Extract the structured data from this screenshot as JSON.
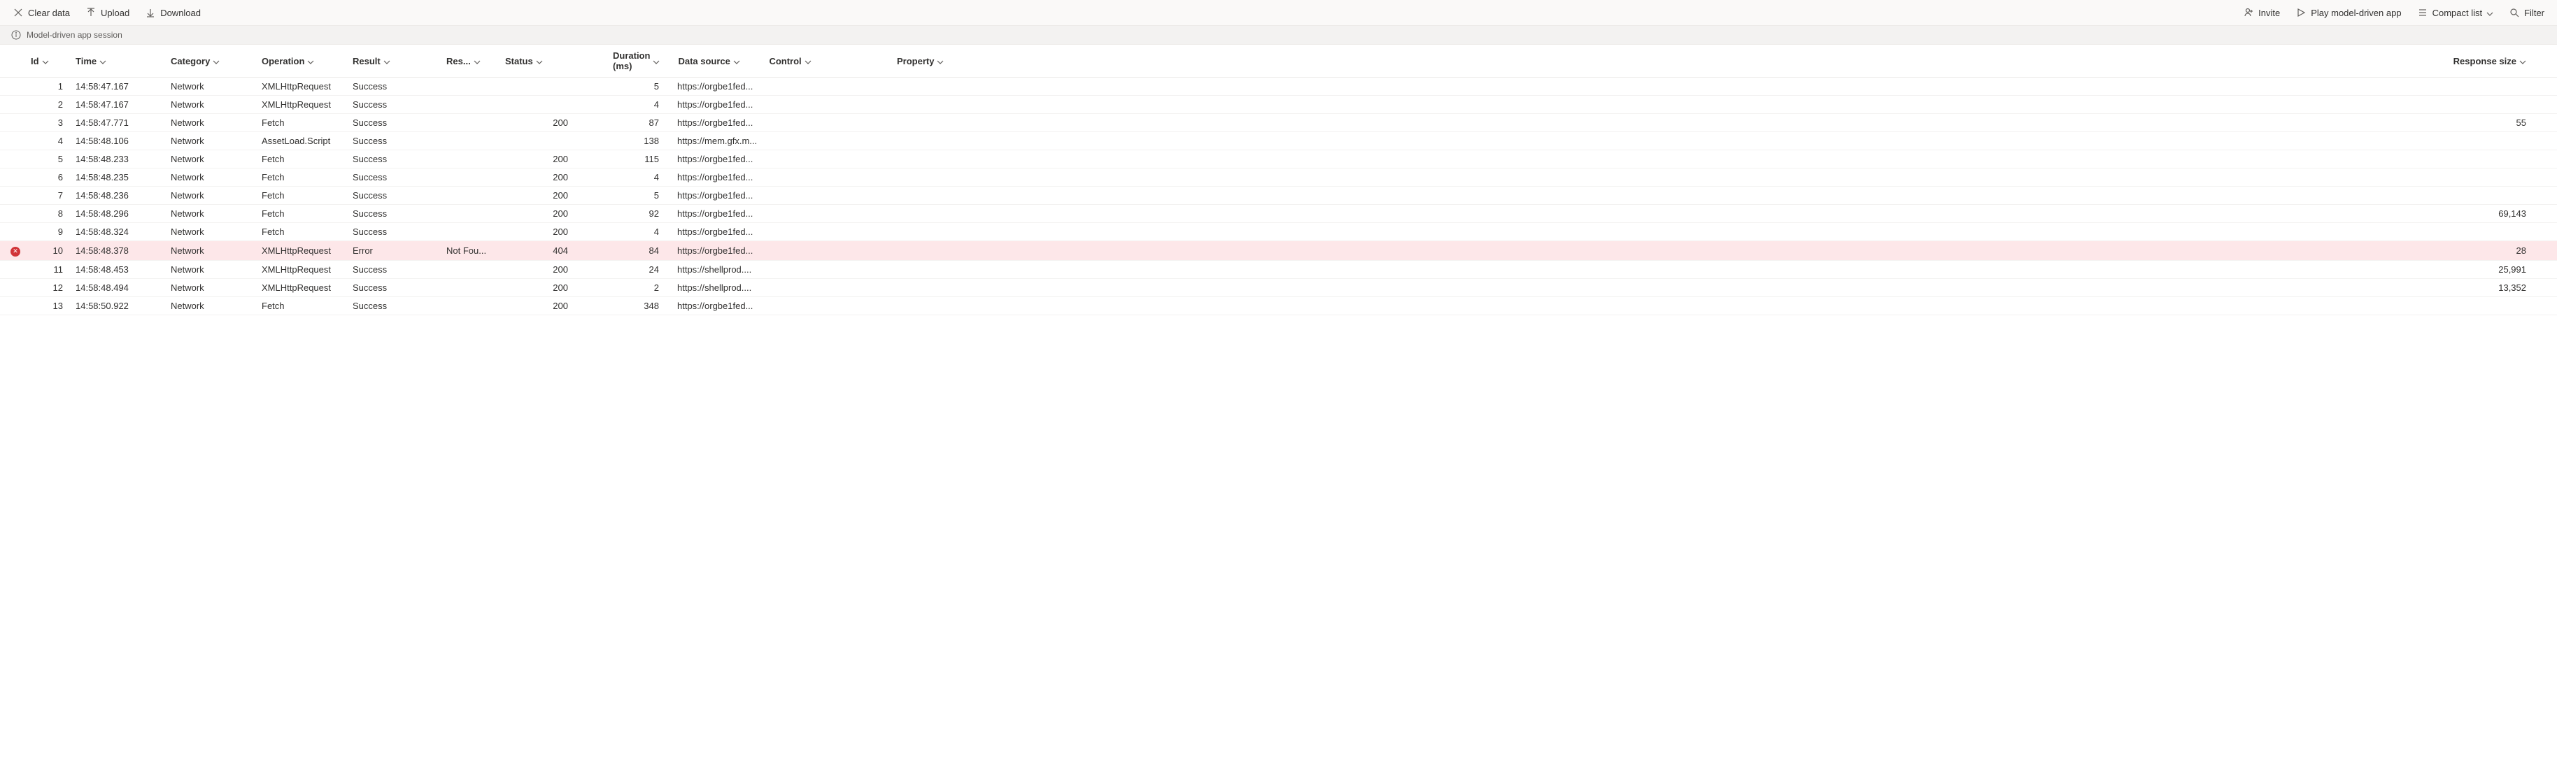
{
  "toolbar": {
    "left": {
      "clear_data": "Clear data",
      "upload": "Upload",
      "download": "Download"
    },
    "right": {
      "invite": "Invite",
      "play": "Play model-driven app",
      "compact": "Compact list",
      "filter": "Filter"
    }
  },
  "session_bar": {
    "label": "Model-driven app session"
  },
  "columns": {
    "id": "Id",
    "time": "Time",
    "category": "Category",
    "operation": "Operation",
    "result": "Result",
    "response": "Res...",
    "status": "Status",
    "duration": "Duration (ms)",
    "data_source": "Data source",
    "control": "Control",
    "property": "Property",
    "response_size": "Response size"
  },
  "rows": [
    {
      "err": false,
      "id": "1",
      "time": "14:58:47.167",
      "category": "Network",
      "operation": "XMLHttpRequest",
      "result": "Success",
      "response": "",
      "status": "",
      "duration": "5",
      "data_source": "https://orgbe1fed...",
      "control": "",
      "property": "",
      "response_size": ""
    },
    {
      "err": false,
      "id": "2",
      "time": "14:58:47.167",
      "category": "Network",
      "operation": "XMLHttpRequest",
      "result": "Success",
      "response": "",
      "status": "",
      "duration": "4",
      "data_source": "https://orgbe1fed...",
      "control": "",
      "property": "",
      "response_size": ""
    },
    {
      "err": false,
      "id": "3",
      "time": "14:58:47.771",
      "category": "Network",
      "operation": "Fetch",
      "result": "Success",
      "response": "",
      "status": "200",
      "duration": "87",
      "data_source": "https://orgbe1fed...",
      "control": "",
      "property": "",
      "response_size": "55"
    },
    {
      "err": false,
      "id": "4",
      "time": "14:58:48.106",
      "category": "Network",
      "operation": "AssetLoad.Script",
      "result": "Success",
      "response": "",
      "status": "",
      "duration": "138",
      "data_source": "https://mem.gfx.m...",
      "control": "",
      "property": "",
      "response_size": ""
    },
    {
      "err": false,
      "id": "5",
      "time": "14:58:48.233",
      "category": "Network",
      "operation": "Fetch",
      "result": "Success",
      "response": "",
      "status": "200",
      "duration": "115",
      "data_source": "https://orgbe1fed...",
      "control": "",
      "property": "",
      "response_size": ""
    },
    {
      "err": false,
      "id": "6",
      "time": "14:58:48.235",
      "category": "Network",
      "operation": "Fetch",
      "result": "Success",
      "response": "",
      "status": "200",
      "duration": "4",
      "data_source": "https://orgbe1fed...",
      "control": "",
      "property": "",
      "response_size": ""
    },
    {
      "err": false,
      "id": "7",
      "time": "14:58:48.236",
      "category": "Network",
      "operation": "Fetch",
      "result": "Success",
      "response": "",
      "status": "200",
      "duration": "5",
      "data_source": "https://orgbe1fed...",
      "control": "",
      "property": "",
      "response_size": ""
    },
    {
      "err": false,
      "id": "8",
      "time": "14:58:48.296",
      "category": "Network",
      "operation": "Fetch",
      "result": "Success",
      "response": "",
      "status": "200",
      "duration": "92",
      "data_source": "https://orgbe1fed...",
      "control": "",
      "property": "",
      "response_size": "69,143"
    },
    {
      "err": false,
      "id": "9",
      "time": "14:58:48.324",
      "category": "Network",
      "operation": "Fetch",
      "result": "Success",
      "response": "",
      "status": "200",
      "duration": "4",
      "data_source": "https://orgbe1fed...",
      "control": "",
      "property": "",
      "response_size": ""
    },
    {
      "err": true,
      "id": "10",
      "time": "14:58:48.378",
      "category": "Network",
      "operation": "XMLHttpRequest",
      "result": "Error",
      "response": "Not Fou...",
      "status": "404",
      "duration": "84",
      "data_source": "https://orgbe1fed...",
      "control": "",
      "property": "",
      "response_size": "28"
    },
    {
      "err": false,
      "id": "11",
      "time": "14:58:48.453",
      "category": "Network",
      "operation": "XMLHttpRequest",
      "result": "Success",
      "response": "",
      "status": "200",
      "duration": "24",
      "data_source": "https://shellprod....",
      "control": "",
      "property": "",
      "response_size": "25,991"
    },
    {
      "err": false,
      "id": "12",
      "time": "14:58:48.494",
      "category": "Network",
      "operation": "XMLHttpRequest",
      "result": "Success",
      "response": "",
      "status": "200",
      "duration": "2",
      "data_source": "https://shellprod....",
      "control": "",
      "property": "",
      "response_size": "13,352"
    },
    {
      "err": false,
      "id": "13",
      "time": "14:58:50.922",
      "category": "Network",
      "operation": "Fetch",
      "result": "Success",
      "response": "",
      "status": "200",
      "duration": "348",
      "data_source": "https://orgbe1fed...",
      "control": "",
      "property": "",
      "response_size": ""
    }
  ]
}
